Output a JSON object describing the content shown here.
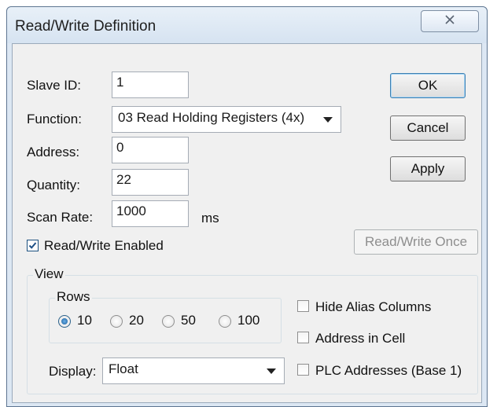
{
  "window": {
    "title": "Read/Write Definition"
  },
  "form": {
    "slave_id": {
      "label": "Slave ID:",
      "value": "1"
    },
    "function": {
      "label": "Function:",
      "value": "03 Read Holding Registers (4x)"
    },
    "address": {
      "label": "Address:",
      "value": "0"
    },
    "quantity": {
      "label": "Quantity:",
      "value": "22"
    },
    "scan_rate": {
      "label": "Scan Rate:",
      "value": "1000",
      "unit": "ms"
    },
    "enabled": {
      "label": "Read/Write Enabled",
      "checked": true
    }
  },
  "buttons": {
    "ok": "OK",
    "cancel": "Cancel",
    "apply": "Apply",
    "read_write_once": "Read/Write Once"
  },
  "view": {
    "title": "View",
    "rows": {
      "title": "Rows",
      "options": [
        "10",
        "20",
        "50",
        "100"
      ],
      "selected": "10"
    },
    "display": {
      "label": "Display:",
      "value": "Float"
    },
    "options": {
      "hide_alias": {
        "label": "Hide Alias Columns",
        "checked": false
      },
      "address_in_cell": {
        "label": "Address in Cell",
        "checked": false
      },
      "plc_addresses": {
        "label": "PLC Addresses (Base 1)",
        "checked": false
      }
    }
  },
  "colors": {
    "title_bar": "#d6e3f1",
    "client_bg": "#f0f0f0",
    "default_button_border": "#3c7fb1"
  },
  "icons": {
    "close": "close-x-icon",
    "dropdown": "chevron-down-icon",
    "check": "checkmark-icon"
  }
}
